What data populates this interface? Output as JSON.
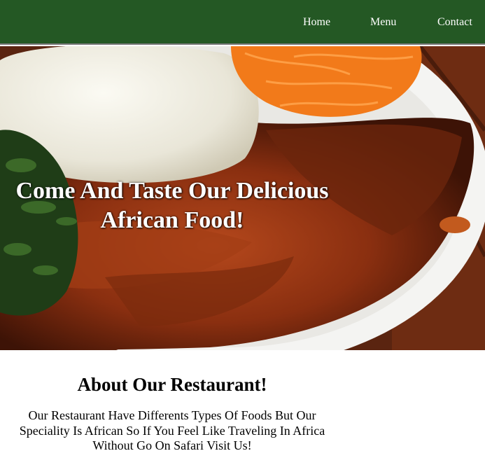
{
  "nav": {
    "home": "Home",
    "menu": "Menu",
    "contact": "Contact"
  },
  "hero": {
    "title_line1": "Come And Taste Our Delicious",
    "title_line2": "African Food!"
  },
  "about": {
    "title": "About Our Restaurant!",
    "text": "Our Restaurant Have Differents Types Of Foods But Our Speciality Is African So If You Feel Like Traveling In Africa Without Go On Safari Visit Us!"
  },
  "colors": {
    "navbar": "#245824",
    "nav_text": "#ffffff",
    "body_bg": "#ffffff"
  }
}
